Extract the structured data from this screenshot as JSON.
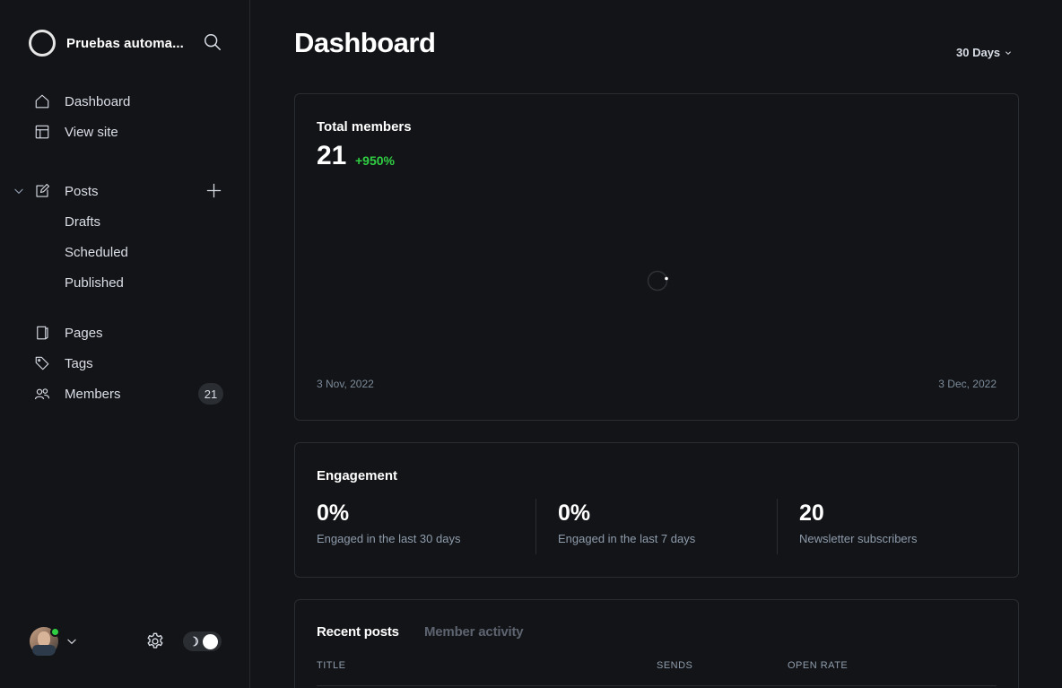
{
  "sidebar": {
    "site_title": "Pruebas automa...",
    "nav": [
      {
        "label": "Dashboard",
        "icon": "home-icon"
      },
      {
        "label": "View site",
        "icon": "layout-icon"
      },
      {
        "label": "Posts",
        "icon": "edit-icon"
      },
      {
        "label": "Drafts"
      },
      {
        "label": "Scheduled"
      },
      {
        "label": "Published"
      },
      {
        "label": "Pages",
        "icon": "pages-icon"
      },
      {
        "label": "Tags",
        "icon": "tag-icon"
      },
      {
        "label": "Members",
        "icon": "members-icon",
        "badge": "21"
      }
    ]
  },
  "header": {
    "title": "Dashboard",
    "range": "30 Days"
  },
  "members": {
    "heading": "Total members",
    "value": "21",
    "change": "+950%",
    "start_date": "3 Nov, 2022",
    "end_date": "3 Dec, 2022"
  },
  "engagement": {
    "heading": "Engagement",
    "metrics": [
      {
        "value": "0%",
        "label": "Engaged in the last 30 days"
      },
      {
        "value": "0%",
        "label": "Engaged in the last 7 days"
      },
      {
        "value": "20",
        "label": "Newsletter subscribers"
      }
    ]
  },
  "recent": {
    "tabs": [
      "Recent posts",
      "Member activity"
    ],
    "columns": [
      "TITLE",
      "SENDS",
      "OPEN RATE"
    ]
  },
  "colors": {
    "background": "#131417",
    "positive": "#30cf43",
    "border": "#2a2d31"
  }
}
